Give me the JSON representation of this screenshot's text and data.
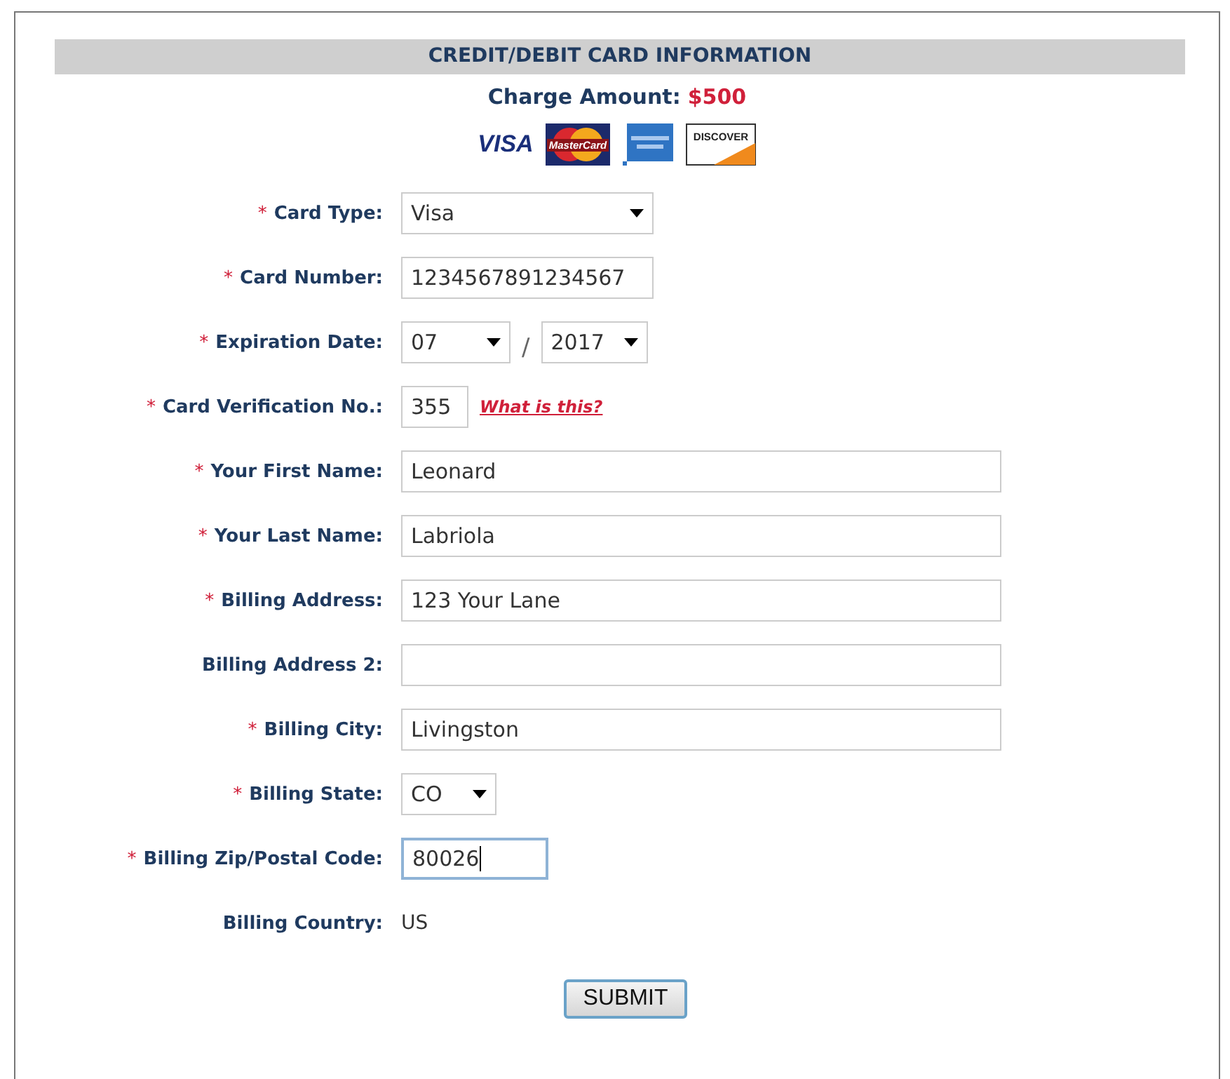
{
  "header": {
    "title": "CREDIT/DEBIT CARD INFORMATION"
  },
  "charge": {
    "label": "Charge Amount:",
    "amount": "$500"
  },
  "card_logos": [
    {
      "kind": "visa",
      "label": "VISA"
    },
    {
      "kind": "mastercard",
      "label": "MasterCard"
    },
    {
      "kind": "amex"
    },
    {
      "kind": "discover",
      "label": "DISCOVER"
    }
  ],
  "fields": [
    {
      "kind": "select_medium",
      "marker": "*",
      "label": "Card Type:",
      "value": "Visa"
    },
    {
      "kind": "text_medium",
      "marker": "*",
      "label": "Card Number:",
      "value": "1234567891234567",
      "focused": false
    },
    {
      "kind": "expiry",
      "marker": "*",
      "label": "Expiration Date:",
      "month": "07",
      "separator": "/",
      "year": "2017"
    },
    {
      "kind": "cvv",
      "marker": "*",
      "label": "Card Verification No.:",
      "value": "355",
      "focused": false,
      "link": "What is this?"
    },
    {
      "kind": "text_long",
      "marker": "*",
      "label": "Your First Name:",
      "value": "Leonard",
      "focused": false
    },
    {
      "kind": "text_long",
      "marker": "*",
      "label": "Your Last Name:",
      "value": "Labriola",
      "focused": false
    },
    {
      "kind": "text_long",
      "marker": "*",
      "label": "Billing Address:",
      "value": "123 Your Lane",
      "focused": false
    },
    {
      "kind": "text_long",
      "label": "Billing Address 2:",
      "focused": false
    },
    {
      "kind": "text_long",
      "marker": "*",
      "label": "Billing City:",
      "value": "Livingston",
      "focused": false
    },
    {
      "kind": "select_short",
      "marker": "*",
      "label": "Billing State:",
      "value": "CO"
    },
    {
      "kind": "text_short",
      "marker": "*",
      "label": "Billing Zip/Postal Code:",
      "value": "80026",
      "focused": true
    },
    {
      "kind": "static",
      "label": "Billing Country:",
      "value": "US"
    }
  ],
  "submit": {
    "label": "SUBMIT"
  }
}
